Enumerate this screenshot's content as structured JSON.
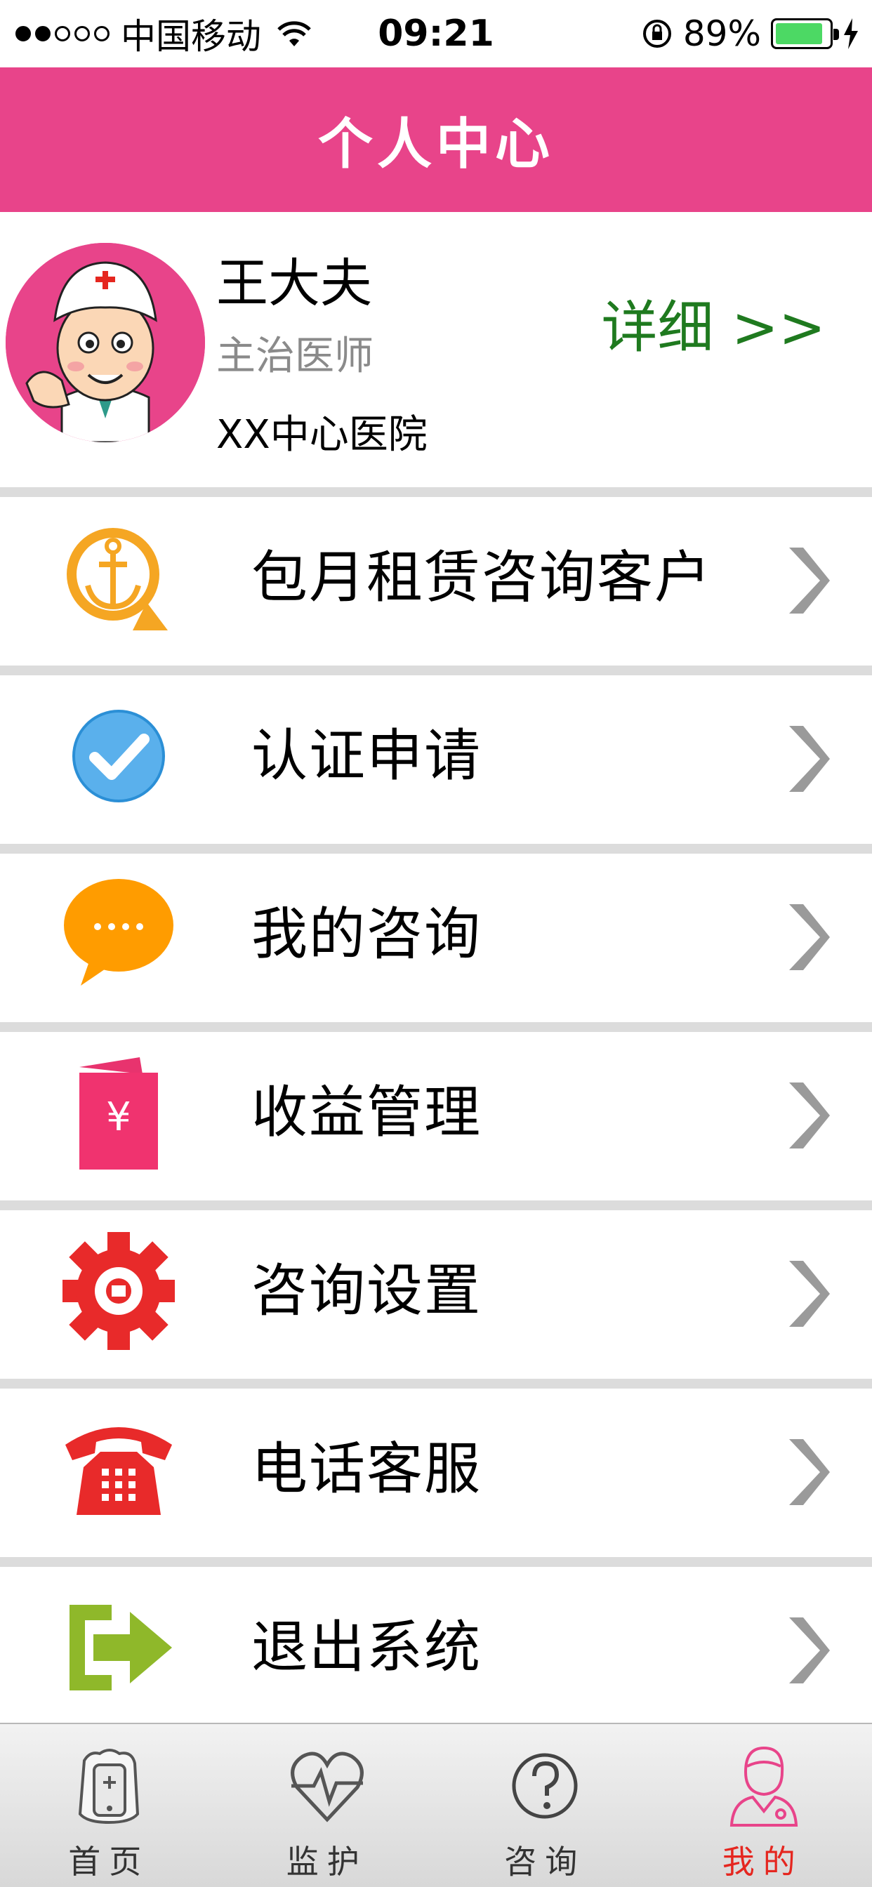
{
  "status_bar": {
    "carrier": "中国移动",
    "time": "09:21",
    "battery": "89%",
    "battery_level": 0.89
  },
  "nav": {
    "title": "个人中心"
  },
  "profile": {
    "name": "王大夫",
    "title": "主治医师",
    "hospital": "XX中心医院",
    "detail_link": "详细 >>"
  },
  "menu": [
    {
      "label": "包月租赁咨询客户",
      "icon": "anchor-icon"
    },
    {
      "label": "认证申请",
      "icon": "checkmark-icon"
    },
    {
      "label": "我的咨询",
      "icon": "chat-bubble-icon"
    },
    {
      "label": "收益管理",
      "icon": "yuan-wallet-icon"
    },
    {
      "label": "咨询设置",
      "icon": "gear-icon"
    },
    {
      "label": "电话客服",
      "icon": "telephone-icon"
    },
    {
      "label": "退出系统",
      "icon": "logout-icon"
    }
  ],
  "tabs": [
    {
      "label": "首页",
      "icon": "home-phone-icon"
    },
    {
      "label": "监护",
      "icon": "heartbeat-icon"
    },
    {
      "label": "咨询",
      "icon": "question-icon"
    },
    {
      "label": "我的",
      "icon": "doctor-icon",
      "active": true
    }
  ],
  "colors": {
    "brand": "#e8448a",
    "detail": "#1f7a1f",
    "active_tab": "#e5261f"
  }
}
